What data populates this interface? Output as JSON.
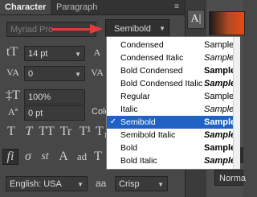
{
  "tabs": [
    {
      "label": "Character"
    },
    {
      "label": "Paragraph"
    }
  ],
  "panel_menu_icon": "panel-menu-icon",
  "font_family": {
    "value": "Myriad Pro"
  },
  "font_style": {
    "value": "Semibold"
  },
  "font_size": {
    "value": "14 pt"
  },
  "kerning": {
    "value": "0"
  },
  "vertical_scale": {
    "value": "100%"
  },
  "baseline_shift": {
    "value": "0 pt"
  },
  "color_label": "Colo",
  "type_style_buttons": [
    "T",
    "T",
    "TT",
    "Tr",
    "T¹",
    "T₁",
    "T",
    "T"
  ],
  "opentype_buttons": [
    "fi",
    "σ",
    "st",
    "A",
    "ad",
    "T",
    "1st",
    "½"
  ],
  "language": {
    "value": "English: USA"
  },
  "aa_label": "aa",
  "anti_alias": {
    "value": "Crisp"
  },
  "normal_button": "Norma",
  "dropdown": {
    "items": [
      {
        "name": "Condensed",
        "sample": "Sample",
        "selected": false
      },
      {
        "name": "Condensed Italic",
        "sample": "Sample",
        "selected": false
      },
      {
        "name": "Bold Condensed",
        "sample": "Sample",
        "selected": false
      },
      {
        "name": "Bold Condensed Italic",
        "sample": "Sample",
        "selected": false
      },
      {
        "name": "Regular",
        "sample": "Sample",
        "selected": false
      },
      {
        "name": "Italic",
        "sample": "Sample",
        "selected": false
      },
      {
        "name": "Semibold",
        "sample": "Sample",
        "selected": true
      },
      {
        "name": "Semibold Italic",
        "sample": "Sample",
        "selected": false
      },
      {
        "name": "Bold",
        "sample": "Sample",
        "selected": false
      },
      {
        "name": "Bold Italic",
        "sample": "Sample",
        "selected": false
      }
    ],
    "check_glyph": "✓"
  },
  "colors": {
    "accent_selection": "#1f62c4",
    "annotation_arrow": "#e23b3b"
  }
}
